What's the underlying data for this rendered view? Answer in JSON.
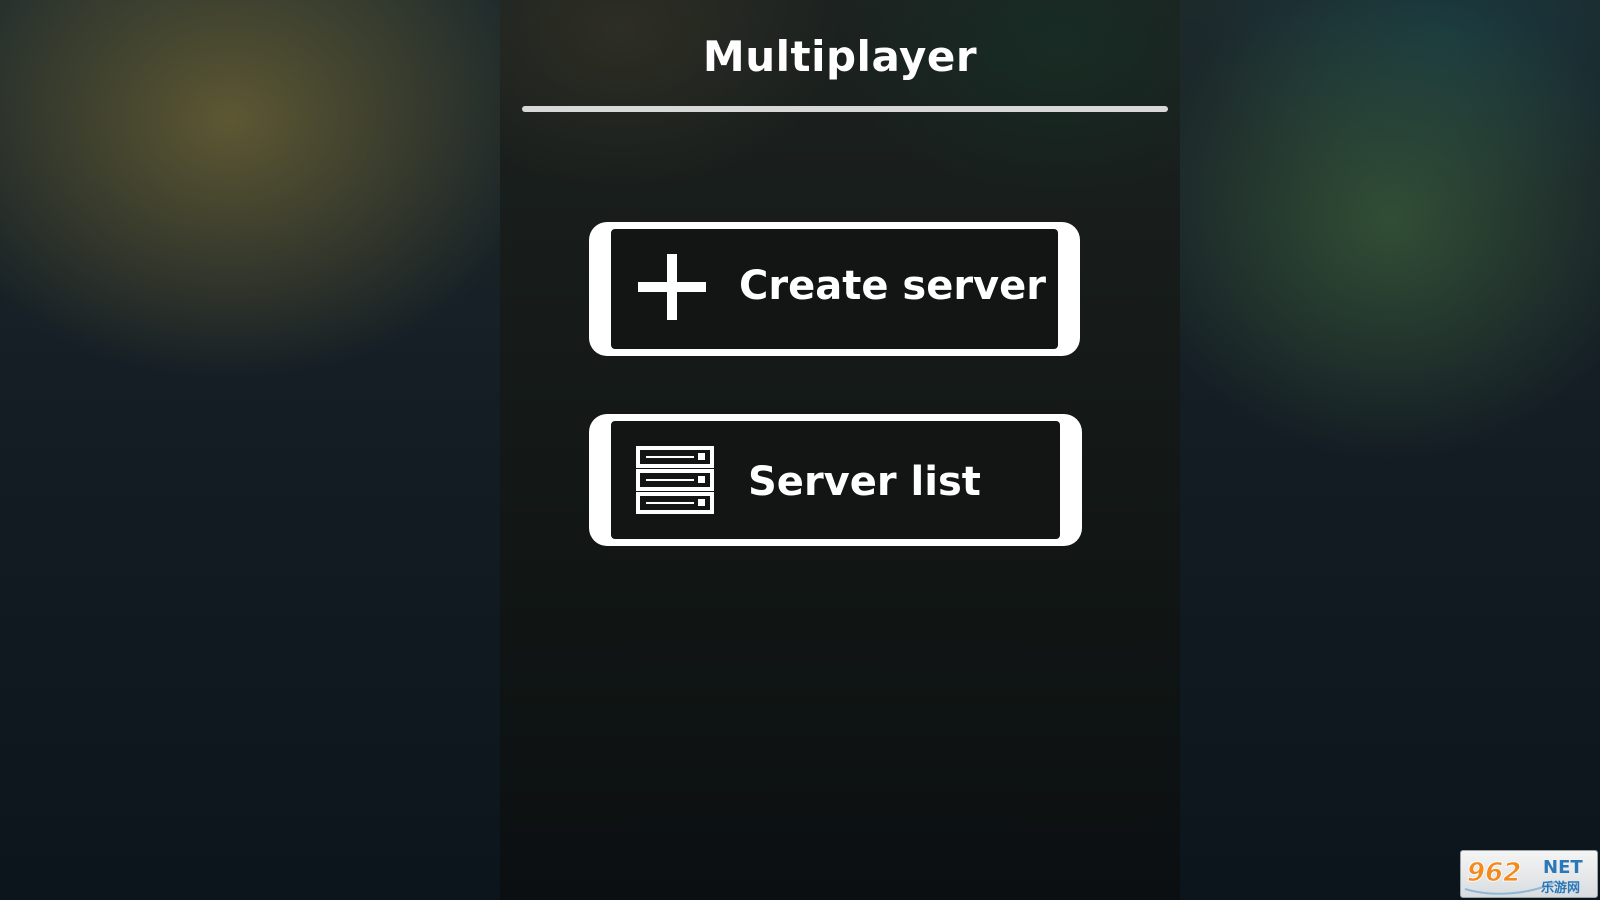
{
  "screen": {
    "title": "Multiplayer"
  },
  "buttons": {
    "create_server": {
      "label": "Create server",
      "icon": "plus-icon"
    },
    "server_list": {
      "label": "Server list",
      "icon": "server-rack-icon"
    }
  },
  "watermark": {
    "number": "962",
    "suffix": "NET",
    "chinese": "乐游网"
  },
  "colors": {
    "button_border": "#ffffff",
    "button_fill": "#121514",
    "text": "#ffffff",
    "watermark_number": "#f28a1e",
    "watermark_text": "#2a78b8"
  }
}
